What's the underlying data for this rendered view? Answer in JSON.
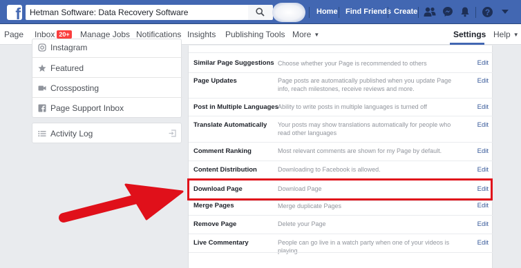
{
  "topbar": {
    "search_value": "Hetman  Software: Data Recovery Software",
    "nav": [
      "Home",
      "Find Friends",
      "Create"
    ],
    "icons": [
      "friends-icon",
      "messenger-icon",
      "notifications-icon",
      "help-icon",
      "menu-caret-icon"
    ]
  },
  "pagenav": {
    "page": "Page",
    "inbox": "Inbox",
    "inbox_badge": "20+",
    "manage_jobs": "Manage Jobs",
    "notifications": "Notifications",
    "insights": "Insights",
    "publishing_tools": "Publishing Tools",
    "more": "More",
    "settings": "Settings",
    "help": "Help"
  },
  "sidebar": {
    "items": [
      {
        "label": "Instagram",
        "icon": "instagram-icon"
      },
      {
        "label": "Featured",
        "icon": "star-icon"
      },
      {
        "label": "Crossposting",
        "icon": "video-camera-icon"
      },
      {
        "label": "Page Support Inbox",
        "icon": "facebook-square-icon"
      }
    ],
    "activity_log": "Activity Log"
  },
  "settings_rows": [
    {
      "title": "Similar Page Suggestions",
      "desc": "Choose whether your Page is recommended to others",
      "edit": "Edit"
    },
    {
      "title": "Page Updates",
      "desc": "Page posts are automatically published when you update Page info, reach milestones, receive reviews and more.",
      "edit": "Edit"
    },
    {
      "title": "Post in Multiple Languages",
      "desc": "Ability to write posts in multiple languages is turned off",
      "edit": "Edit"
    },
    {
      "title": "Translate Automatically",
      "desc": "Your posts may show translations automatically for people who read other languages",
      "edit": "Edit"
    },
    {
      "title": "Comment Ranking",
      "desc": "Most relevant comments are shown for my Page by default.",
      "edit": "Edit"
    },
    {
      "title": "Content Distribution",
      "desc": "Downloading to Facebook is allowed.",
      "edit": "Edit"
    },
    {
      "title": "Download Page",
      "desc": "Download Page",
      "edit": "Edit"
    },
    {
      "title": "Merge Pages",
      "desc": "Merge duplicate Pages",
      "edit": "Edit"
    },
    {
      "title": "Remove Page",
      "desc": "Delete your Page",
      "edit": "Edit"
    },
    {
      "title": "Live Commentary",
      "desc": "People can go live in a watch party when one of your videos is playing.",
      "edit": "Edit"
    }
  ],
  "colors": {
    "brand": "#4267b2",
    "highlight": "#e0101a",
    "link": "#365899"
  }
}
